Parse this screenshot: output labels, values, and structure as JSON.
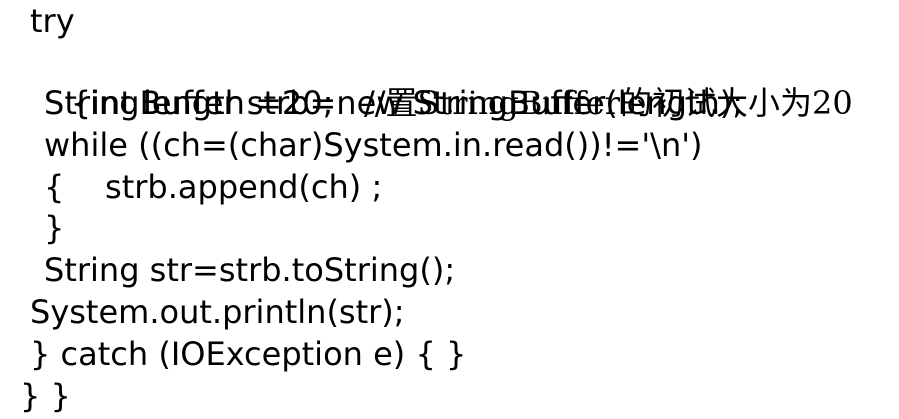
{
  "code": {
    "lines": [
      "try",
      "{int length =20;   //",
      "StringBuffer strb=new StringBuffer(length);",
      "while ((ch=(char)System.in.read())!='\\n')",
      "{    strb.append(ch) ;",
      "}",
      "String str=strb.toString();",
      "System.out.println(str);",
      "} catch (IOException e) { }",
      "} }"
    ],
    "comment_text": "置StringBuffer的初试大小为20"
  }
}
